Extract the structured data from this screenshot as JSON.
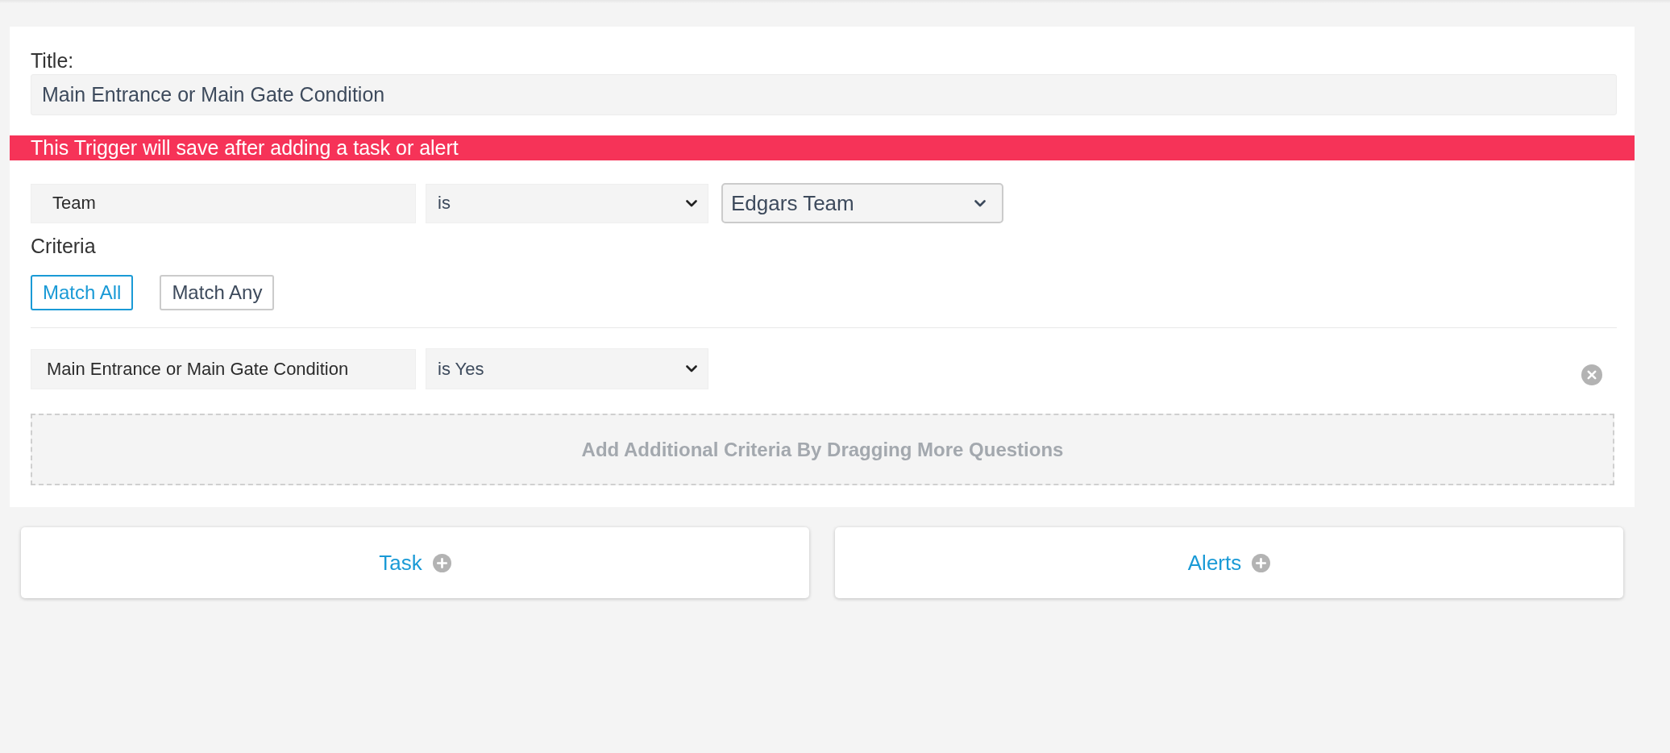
{
  "title_field": {
    "label": "Title:",
    "value": "Main Entrance or Main Gate Condition"
  },
  "banner": {
    "text": "This Trigger will save after adding a task or alert"
  },
  "team_rule": {
    "field": "Team",
    "operator": "is",
    "value": "Edgars Team"
  },
  "criteria": {
    "label": "Criteria",
    "match_options": [
      {
        "label": "Match All",
        "selected": true
      },
      {
        "label": "Match Any",
        "selected": false
      }
    ],
    "rules": [
      {
        "field": "Main Entrance or Main Gate Condition",
        "operator": "is Yes"
      }
    ],
    "drop_zone": "Add Additional Criteria By Dragging More Questions"
  },
  "actions": [
    {
      "label": "Task"
    },
    {
      "label": "Alerts"
    }
  ]
}
